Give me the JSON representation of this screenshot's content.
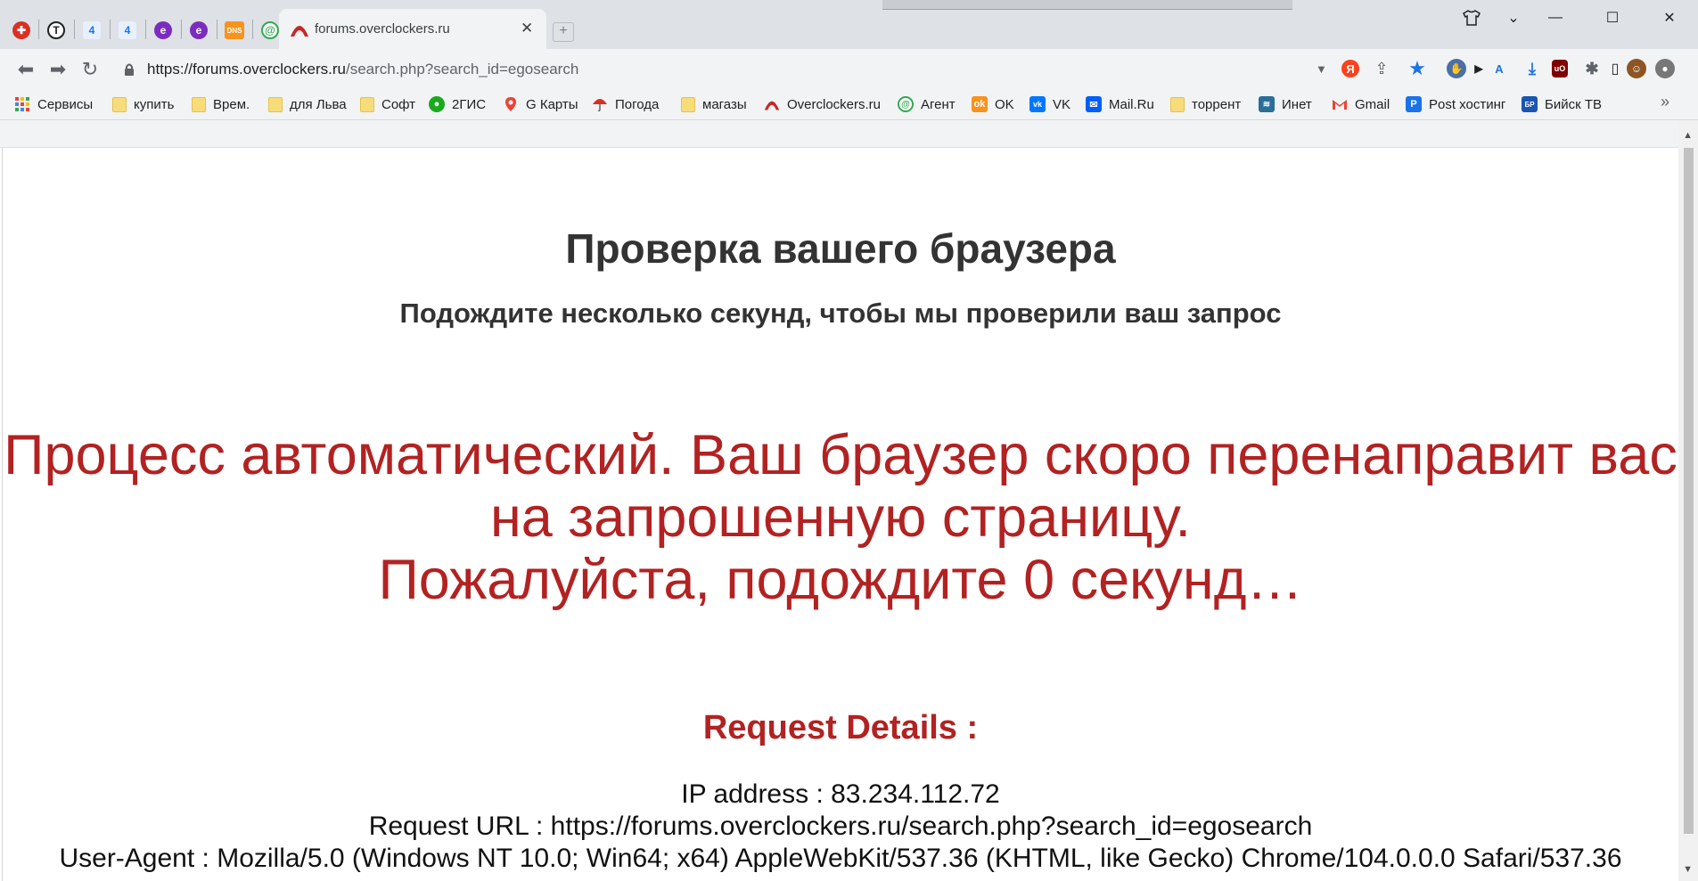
{
  "window": {
    "controls": [
      "shirt-icon",
      "chevron-down-icon",
      "minimize-icon",
      "maximize-icon",
      "close-icon"
    ]
  },
  "tabs": {
    "pinned": [
      {
        "name": "red-star-icon",
        "color": "#d93025",
        "glyph": "✚"
      },
      {
        "name": "circle-t-icon",
        "color": "#202124",
        "glyph": "T"
      },
      {
        "name": "letter-4-icon",
        "color": "#1a73e8",
        "glyph": "4"
      },
      {
        "name": "letter-4-icon",
        "color": "#1a73e8",
        "glyph": "4"
      },
      {
        "name": "purple-e-icon",
        "color": "#7b2cbf",
        "glyph": "e"
      },
      {
        "name": "purple-e-icon",
        "color": "#7b2cbf",
        "glyph": "e"
      },
      {
        "name": "dns-icon",
        "color": "#f7941d",
        "glyph": "DNS"
      },
      {
        "name": "at-sign-icon",
        "color": "#34a853",
        "glyph": "@"
      }
    ],
    "active": {
      "title": "forums.overclockers.ru"
    }
  },
  "toolbar": {
    "url_host": "https://forums.overclockers.ru",
    "url_path": "/search.php?search_id=egosearch"
  },
  "bookmarks": [
    {
      "label": "Сервисы",
      "icon": "apps-grid-icon",
      "color": "#ea4335"
    },
    {
      "label": "купить",
      "icon": "folder-icon",
      "color": "#f8dc7a"
    },
    {
      "label": "Врем.",
      "icon": "folder-icon",
      "color": "#f8dc7a"
    },
    {
      "label": "для Льва",
      "icon": "folder-icon",
      "color": "#f8dc7a"
    },
    {
      "label": "Софт",
      "icon": "folder-icon",
      "color": "#f8dc7a"
    },
    {
      "label": "2ГИС",
      "icon": "2gis-icon",
      "color": "#19aa1e"
    },
    {
      "label": "G Карты",
      "icon": "maps-pin-icon",
      "color": "#ea4335"
    },
    {
      "label": "Погода",
      "icon": "umbrella-icon",
      "color": "#d93025"
    },
    {
      "label": "магазы",
      "icon": "folder-icon",
      "color": "#f8dc7a"
    },
    {
      "label": "Overclockers.ru",
      "icon": "overclockers-icon",
      "color": "#c62828"
    },
    {
      "label": "Агент",
      "icon": "at-sign-icon",
      "color": "#34a853"
    },
    {
      "label": "OK",
      "icon": "odnoklassniki-icon",
      "color": "#f7931e"
    },
    {
      "label": "VK",
      "icon": "vk-icon",
      "color": "#0077ff"
    },
    {
      "label": "Mail.Ru",
      "icon": "mail-icon",
      "color": "#005ff9"
    },
    {
      "label": "торрент",
      "icon": "folder-icon",
      "color": "#f8dc7a"
    },
    {
      "label": "Инет",
      "icon": "network-icon",
      "color": "#2a6f97"
    },
    {
      "label": "Gmail",
      "icon": "gmail-icon",
      "color": "#ea4335"
    },
    {
      "label": "Post хостинг",
      "icon": "post-icon",
      "color": "#1a73e8"
    },
    {
      "label": "Бийск ТВ",
      "icon": "tv-icon",
      "color": "#1a56b0"
    }
  ],
  "page": {
    "title": "Проверка вашего браузера",
    "subtitle": "Подождите несколько секунд, чтобы мы проверили ваш запрос",
    "message_line1": "Процесс автоматический. Ваш браузер скоро перенаправит вас",
    "message_line2": "на запрошенную страницу.",
    "message_line3": "Пожалуйста, подождите 0 секунд…",
    "details_title": "Request Details :",
    "ip": "IP address : 83.234.112.72",
    "request_url": "Request URL : https://forums.overclockers.ru/search.php?search_id=egosearch",
    "user_agent": "User-Agent : Mozilla/5.0 (Windows NT 10.0; Win64; x64) AppleWebKit/537.36 (KHTML, like Gecko) Chrome/104.0.0.0 Safari/537.36"
  }
}
